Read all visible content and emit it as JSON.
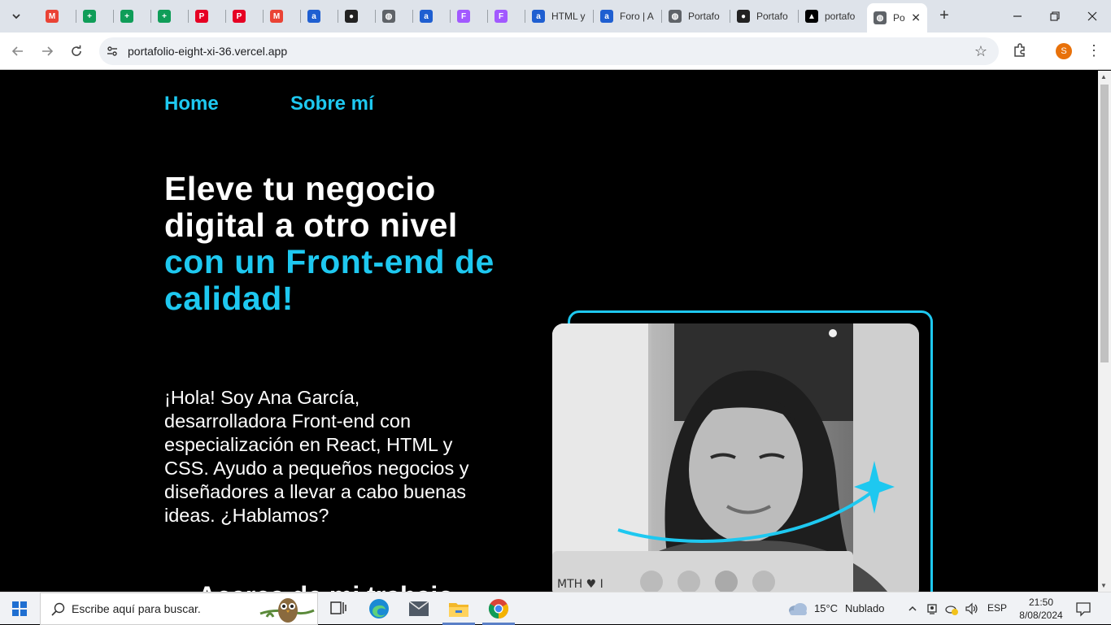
{
  "browser": {
    "tabs": [
      {
        "icon": "gmail-icon",
        "title": ""
      },
      {
        "icon": "sheets-icon",
        "title": ""
      },
      {
        "icon": "sheets-icon",
        "title": ""
      },
      {
        "icon": "sheets-icon",
        "title": ""
      },
      {
        "icon": "pinterest-icon",
        "title": ""
      },
      {
        "icon": "pinterest-icon",
        "title": ""
      },
      {
        "icon": "gmail-icon",
        "title": ""
      },
      {
        "icon": "alura-icon",
        "title": ""
      },
      {
        "icon": "github-icon",
        "title": ""
      },
      {
        "icon": "globe-icon",
        "title": ""
      },
      {
        "icon": "alura-icon",
        "title": ""
      },
      {
        "icon": "figma-icon",
        "title": ""
      },
      {
        "icon": "figma-icon",
        "title": ""
      },
      {
        "icon": "alura-icon",
        "title": "HTML y"
      },
      {
        "icon": "alura-icon",
        "title": "Foro | A"
      },
      {
        "icon": "globe-icon",
        "title": "Portafo"
      },
      {
        "icon": "github-icon",
        "title": "Portafo"
      },
      {
        "icon": "vercel-icon",
        "title": "portafo"
      },
      {
        "icon": "globe-icon",
        "title": "Po",
        "active": true
      }
    ],
    "url": "portafolio-eight-xi-36.vercel.app",
    "profile_initial": "S"
  },
  "site": {
    "nav": {
      "home": "Home",
      "about": "Sobre mí"
    },
    "hero": {
      "title_white": "Eleve tu negocio digital a otro nivel",
      "title_accent": "con un Front-end de calidad!",
      "intro": "¡Hola! Soy Ana García, desarrolladora Front-end con especialización en React, HTML y CSS. Ayudo a pequeños negocios y diseñadores a llevar a cabo buenas ideas. ¿Hablamos?",
      "next_heading_partial": "Acerca de mi trabajo"
    },
    "photo_sticker_text": "MTH ♥ I",
    "colors": {
      "accent": "#1ec8f0",
      "background": "#000000"
    }
  },
  "taskbar": {
    "search_placeholder": "Escribe aquí para buscar.",
    "weather_temp": "15°C",
    "weather_condition": "Nublado",
    "language": "ESP",
    "time": "21:50",
    "date": "8/08/2024"
  }
}
